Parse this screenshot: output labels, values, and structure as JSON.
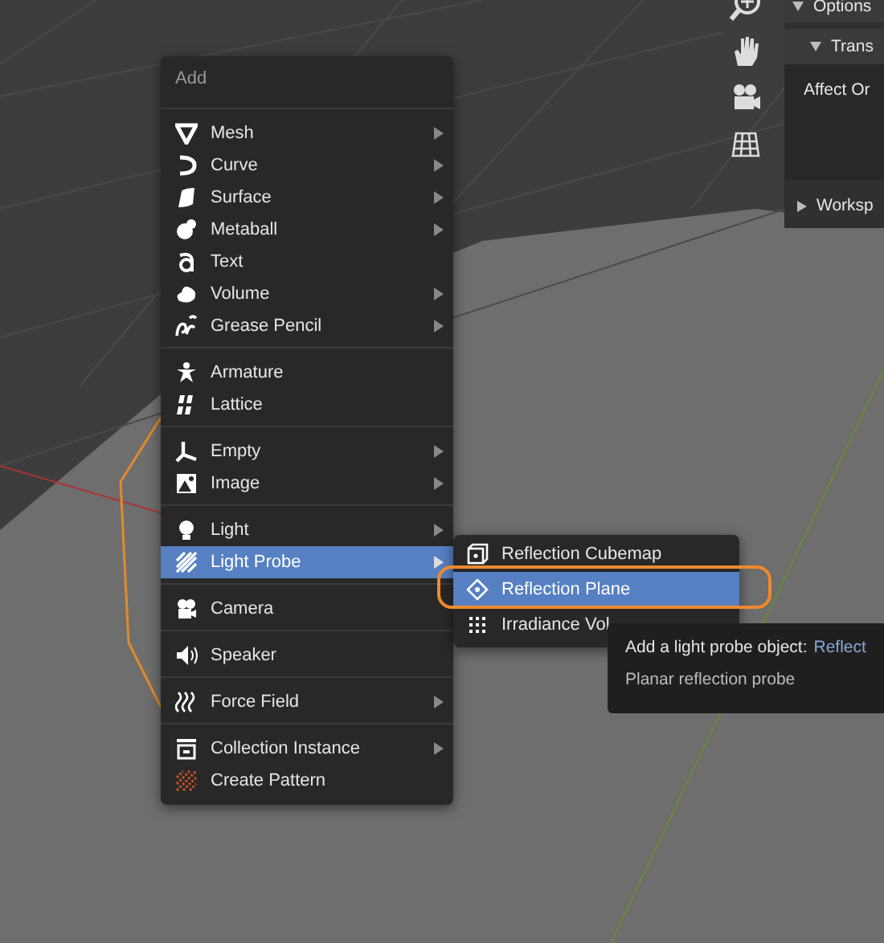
{
  "properties_panel": {
    "rows": [
      {
        "label": "Options",
        "kind": "header"
      },
      {
        "label": "Trans",
        "kind": "subheader"
      },
      {
        "label": "Affect Or",
        "kind": "field"
      },
      {
        "label": "Worksp",
        "kind": "collapsed"
      }
    ]
  },
  "add_menu": {
    "title": "Add",
    "sections": [
      {
        "items": [
          {
            "label": "Mesh",
            "submenu": true,
            "selected": false
          },
          {
            "label": "Curve",
            "submenu": true,
            "selected": false
          },
          {
            "label": "Surface",
            "submenu": true,
            "selected": false
          },
          {
            "label": "Metaball",
            "submenu": true,
            "selected": false
          },
          {
            "label": "Text",
            "submenu": false,
            "selected": false
          },
          {
            "label": "Volume",
            "submenu": true,
            "selected": false
          },
          {
            "label": "Grease Pencil",
            "submenu": true,
            "selected": false
          }
        ]
      },
      {
        "items": [
          {
            "label": "Armature",
            "submenu": false,
            "selected": false
          },
          {
            "label": "Lattice",
            "submenu": false,
            "selected": false
          }
        ]
      },
      {
        "items": [
          {
            "label": "Empty",
            "submenu": true,
            "selected": false
          },
          {
            "label": "Image",
            "submenu": true,
            "selected": false
          }
        ]
      },
      {
        "items": [
          {
            "label": "Light",
            "submenu": true,
            "selected": false
          },
          {
            "label": "Light Probe",
            "submenu": true,
            "selected": true
          }
        ]
      },
      {
        "items": [
          {
            "label": "Camera",
            "submenu": false,
            "selected": false
          }
        ]
      },
      {
        "items": [
          {
            "label": "Speaker",
            "submenu": false,
            "selected": false
          }
        ]
      },
      {
        "items": [
          {
            "label": "Force Field",
            "submenu": true,
            "selected": false
          }
        ]
      },
      {
        "items": [
          {
            "label": "Collection Instance",
            "submenu": true,
            "selected": false
          },
          {
            "label": "Create Pattern",
            "submenu": false,
            "selected": false
          }
        ]
      }
    ]
  },
  "light_probe_submenu": {
    "items": [
      {
        "label": "Reflection Cubemap",
        "selected": false
      },
      {
        "label": "Reflection Plane",
        "selected": true
      },
      {
        "label": "Irradiance Vol",
        "selected": false
      }
    ]
  },
  "tooltip": {
    "label": "Add a light probe object:",
    "value": "Reflect",
    "description": "Planar reflection probe"
  }
}
